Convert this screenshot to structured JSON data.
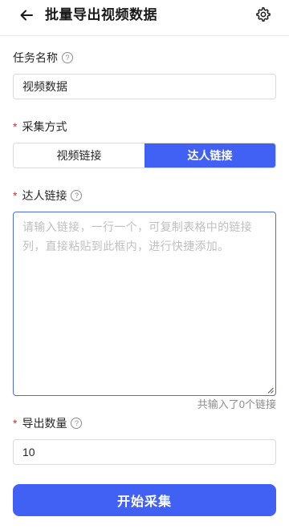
{
  "header": {
    "title": "批量导出视频数据",
    "back_icon": "arrow-left-icon",
    "settings_icon": "gear-icon"
  },
  "task_name": {
    "label": "任务名称",
    "help_glyph": "?",
    "value": "视频数据"
  },
  "collect_method": {
    "required_mark": "*",
    "label": "采集方式",
    "options": [
      "视频链接",
      "达人链接"
    ],
    "selected": "达人链接"
  },
  "influencer_links": {
    "required_mark": "*",
    "label": "达人链接",
    "help_glyph": "?",
    "placeholder": "请输入链接，一行一个，可复制表格中的链接列，直接粘贴到此框内，进行快捷添加。",
    "counter": "共输入了0个链接"
  },
  "export_count": {
    "required_mark": "*",
    "label": "导出数量",
    "help_glyph": "?",
    "value": "10"
  },
  "submit": {
    "label": "开始采集"
  },
  "colors": {
    "primary": "#4161f5",
    "required": "#f5222d",
    "placeholder": "#bfbfbf",
    "border": "#d9d9d9"
  }
}
